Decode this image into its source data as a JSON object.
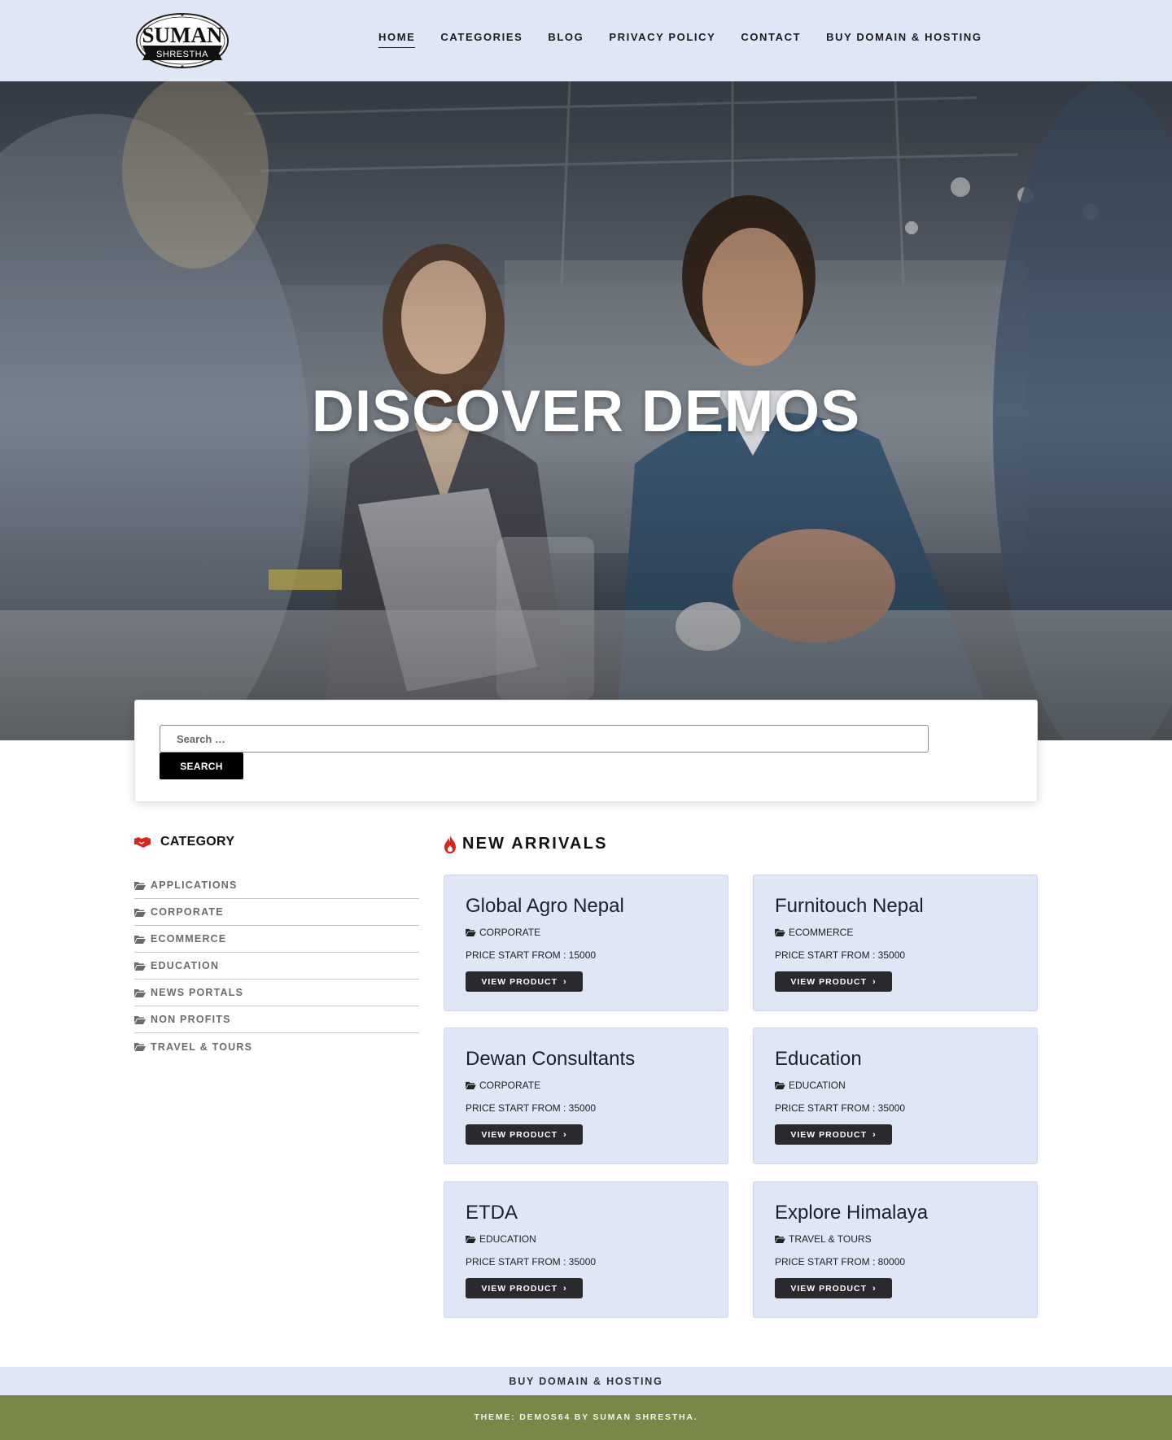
{
  "header": {
    "logo": {
      "line1": "SUMAN",
      "line2": "SHRESTHA"
    },
    "nav": [
      {
        "label": "HOME",
        "active": true
      },
      {
        "label": "CATEGORIES",
        "active": false
      },
      {
        "label": "BLOG",
        "active": false
      },
      {
        "label": "PRIVACY POLICY",
        "active": false
      },
      {
        "label": "CONTACT",
        "active": false
      },
      {
        "label": "BUY DOMAIN & HOSTING",
        "active": false
      }
    ]
  },
  "hero": {
    "title": "DISCOVER DEMOS"
  },
  "search": {
    "placeholder": "Search …",
    "button_label": "SEARCH"
  },
  "sidebar": {
    "title": "CATEGORY",
    "icon": "handshake-icon",
    "items": [
      {
        "label": "APPLICATIONS"
      },
      {
        "label": "CORPORATE"
      },
      {
        "label": "ECOMMERCE"
      },
      {
        "label": "EDUCATION"
      },
      {
        "label": "NEWS PORTALS"
      },
      {
        "label": "NON PROFITS"
      },
      {
        "label": "TRAVEL & TOURS"
      }
    ]
  },
  "arrivals": {
    "title": "NEW ARRIVALS",
    "icon": "fire-icon",
    "button_label": "VIEW PRODUCT",
    "products": [
      {
        "name": "Global Agro Nepal",
        "category": "CORPORATE",
        "price": "PRICE START FROM : 15000"
      },
      {
        "name": "Furnitouch Nepal",
        "category": "ECOMMERCE",
        "price": "PRICE START FROM : 35000"
      },
      {
        "name": "Dewan Consultants",
        "category": "CORPORATE",
        "price": "PRICE START FROM : 35000"
      },
      {
        "name": "Education",
        "category": "EDUCATION",
        "price": "PRICE START FROM : 35000"
      },
      {
        "name": "ETDA",
        "category": "EDUCATION",
        "price": "PRICE START FROM : 35000"
      },
      {
        "name": "Explore Himalaya",
        "category": "TRAVEL & TOURS",
        "price": "PRICE START FROM : 80000"
      }
    ]
  },
  "footer": {
    "link": "BUY DOMAIN & HOSTING",
    "credit": "THEME: DEMOS64 BY SUMAN SHRESTHA."
  },
  "colors": {
    "header_bg": "#dfe6f5",
    "card_bg": "#dfe6f5",
    "accent_red": "#d9261c",
    "footer_green": "#798848",
    "button_dark": "#2a2a2e"
  }
}
